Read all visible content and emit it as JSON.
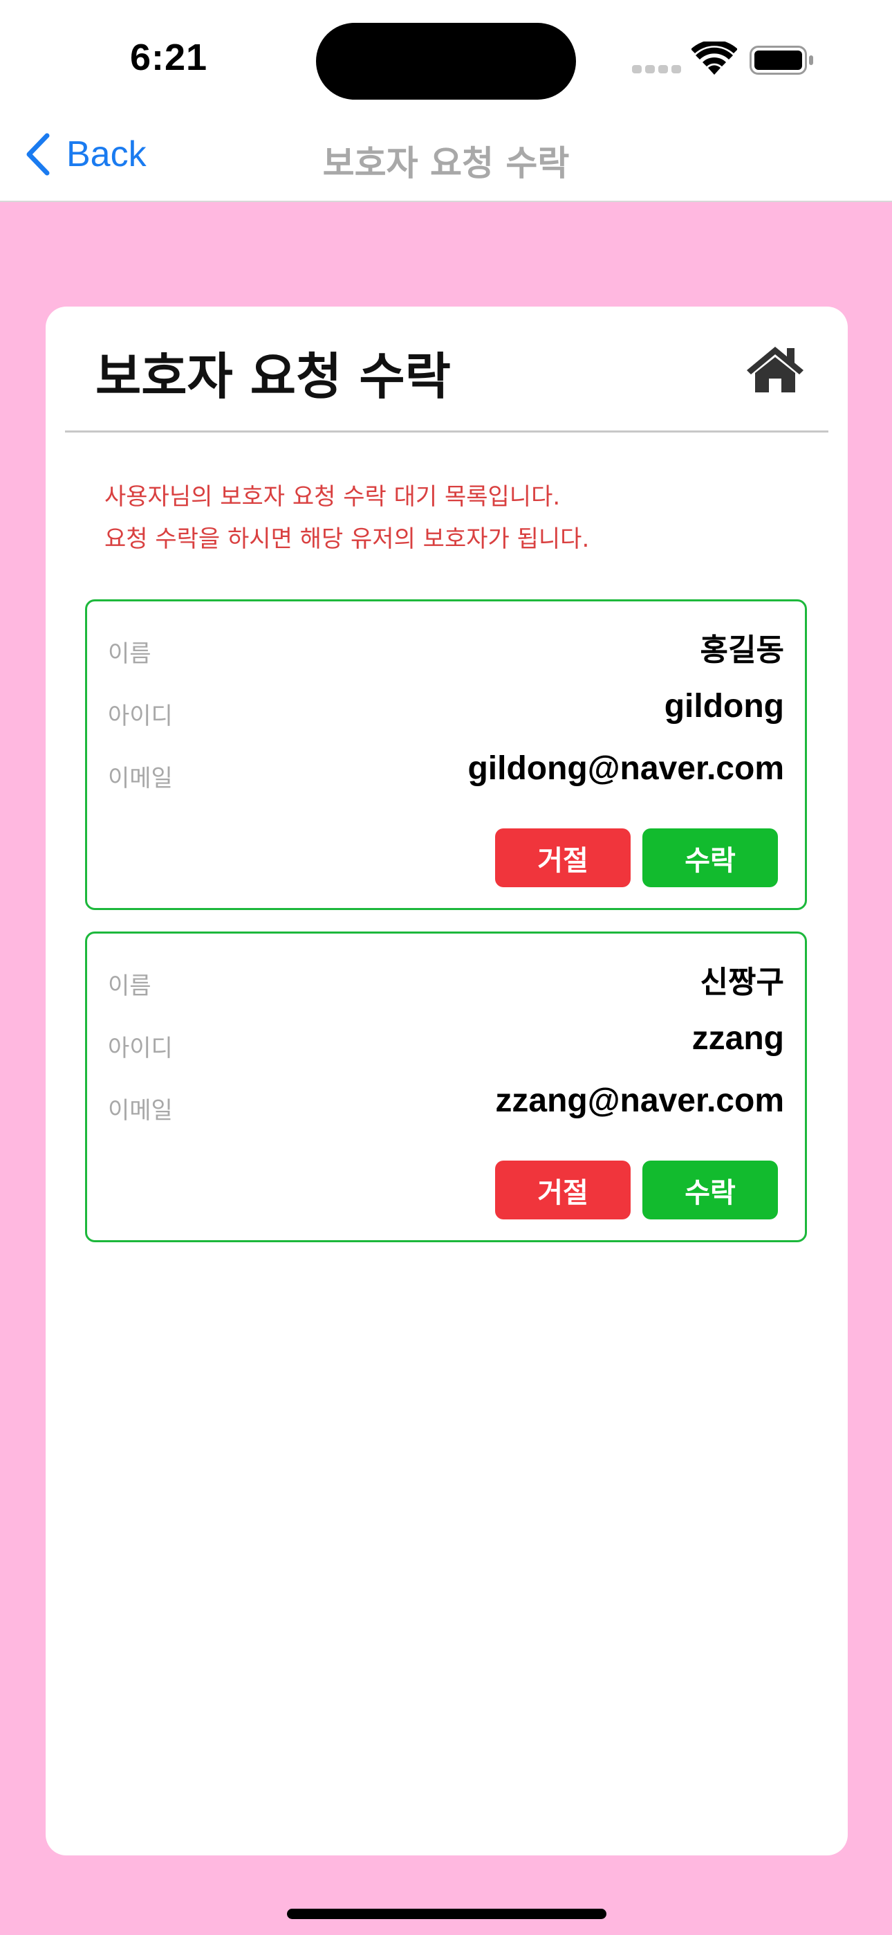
{
  "status_bar": {
    "time": "6:21",
    "icons": [
      "signal-icon",
      "wifi-icon",
      "battery-icon"
    ]
  },
  "nav": {
    "back_label": "Back",
    "title": "보호자 요청 수락"
  },
  "page": {
    "title": "보호자 요청 수락",
    "home_icon": "home-icon",
    "notice_line1": "사용자님의 보호자 요청 수락 대기 목록입니다.",
    "notice_line2": "요청 수락을 하시면 해당 유저의 보호자가 됩니다."
  },
  "labels": {
    "name": "이름",
    "id": "아이디",
    "email": "이메일",
    "reject": "거절",
    "accept": "수락"
  },
  "requests": [
    {
      "name": "홍길동",
      "id": "gildong",
      "email": "gildong@naver.com"
    },
    {
      "name": "신짱구",
      "id": "zzang",
      "email": "zzang@naver.com"
    }
  ],
  "colors": {
    "background": "#ffb8e0",
    "accent_blue": "#1a7bf0",
    "notice_red": "#d94040",
    "reject_red": "#f0353c",
    "accept_green": "#12bb2e",
    "border_green": "#1db83c"
  }
}
